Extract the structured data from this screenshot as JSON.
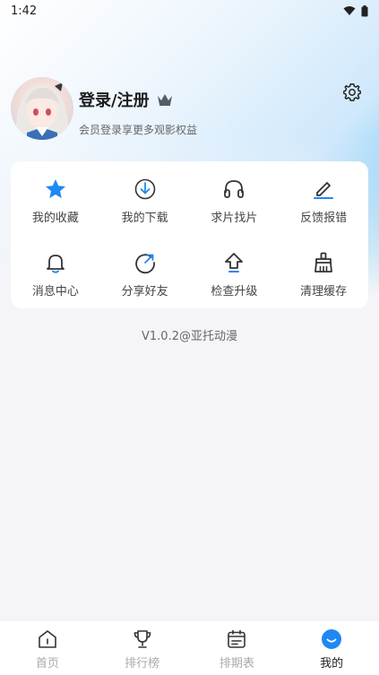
{
  "status_bar": {
    "time": "1:42"
  },
  "profile": {
    "title": "登录/注册",
    "subtitle": "会员登录享更多观影权益"
  },
  "menu": {
    "items": [
      {
        "label": "我的收藏",
        "icon": "star-icon"
      },
      {
        "label": "我的下载",
        "icon": "download-icon"
      },
      {
        "label": "求片找片",
        "icon": "headphones-icon"
      },
      {
        "label": "反馈报错",
        "icon": "edit-icon"
      },
      {
        "label": "消息中心",
        "icon": "bell-icon"
      },
      {
        "label": "分享好友",
        "icon": "share-icon"
      },
      {
        "label": "检查升级",
        "icon": "upgrade-icon"
      },
      {
        "label": "清理缓存",
        "icon": "broom-icon"
      }
    ]
  },
  "version": "V1.0.2@亚托动漫",
  "tabbar": {
    "items": [
      {
        "label": "首页",
        "icon": "home-icon",
        "active": false
      },
      {
        "label": "排行榜",
        "icon": "trophy-icon",
        "active": false
      },
      {
        "label": "排期表",
        "icon": "calendar-icon",
        "active": false
      },
      {
        "label": "我的",
        "icon": "smile-icon",
        "active": true
      }
    ]
  },
  "colors": {
    "accent": "#1e88f5",
    "tab_active": "#222222",
    "tab_inactive": "#aaaaaa"
  }
}
